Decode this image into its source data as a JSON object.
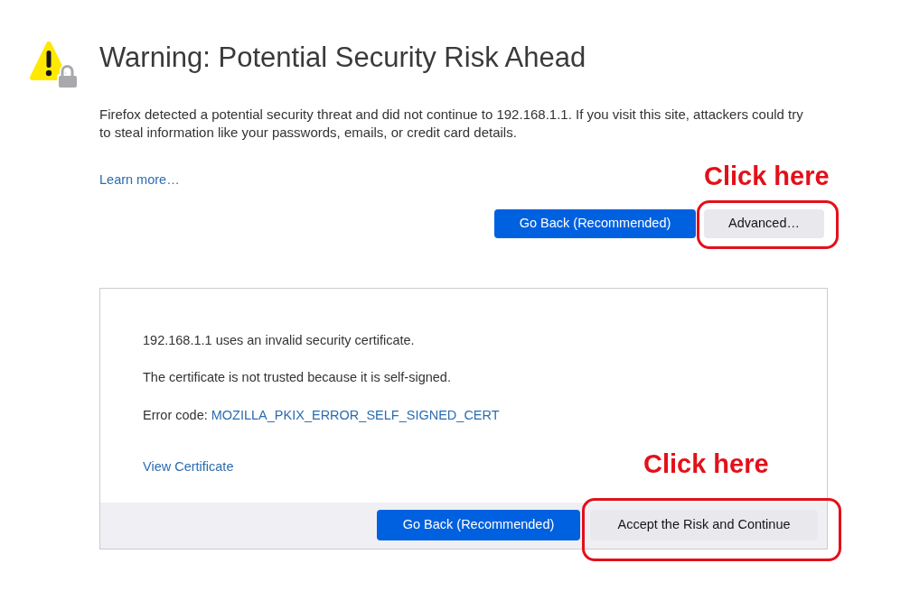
{
  "warning": {
    "title": "Warning: Potential Security Risk Ahead",
    "description": "Firefox detected a potential security threat and did not continue to 192.168.1.1. If you visit this site, attackers could try to steal information like your passwords, emails, or credit card details.",
    "learn_more_link": "Learn more…",
    "buttons": [
      {
        "label": "Go Back (Recommended)",
        "kind": "primary",
        "circled": false
      },
      {
        "label": "Advanced…",
        "kind": "secondary",
        "circled": true,
        "callout": "Click here"
      }
    ]
  },
  "advanced_panel": {
    "messages": [
      "192.168.1.1 uses an invalid security certificate.",
      "The certificate is not trusted because it is self-signed."
    ],
    "error_code": {
      "label": "Error code:",
      "code": "MOZILLA_PKIX_ERROR_SELF_SIGNED_CERT"
    },
    "view_certificate_link": "View Certificate",
    "buttons": [
      {
        "label": "Go Back (Recommended)",
        "kind": "primary",
        "circled": false
      },
      {
        "label": "Accept the Risk and Continue",
        "kind": "secondary",
        "circled": true,
        "callout": "Click here"
      }
    ]
  }
}
